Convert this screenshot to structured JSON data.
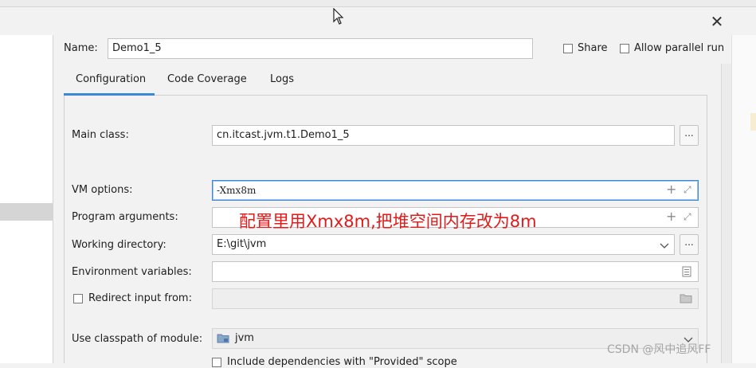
{
  "dialog": {
    "close_glyph": "✕",
    "name_label": "Name:",
    "name_value": "Demo1_5",
    "share_label": "Share",
    "allow_parallel_label": "Allow parallel run"
  },
  "tabs": [
    {
      "label": "Configuration",
      "selected": true
    },
    {
      "label": "Code Coverage",
      "selected": false
    },
    {
      "label": "Logs",
      "selected": false
    }
  ],
  "form": {
    "main_class_label": "Main class:",
    "main_class_value": "cn.itcast.jvm.t1.Demo1_5",
    "vm_options_label": "VM options:",
    "vm_options_value": "-Xmx8m",
    "program_args_label": "Program arguments:",
    "working_dir_label": "Working directory:",
    "working_dir_value": "E:\\git\\jvm",
    "env_vars_label": "Environment variables:",
    "redirect_label": "Redirect input from:",
    "classpath_label": "Use classpath of module:",
    "classpath_value": "jvm",
    "include_deps_label": "Include dependencies with \"Provided\" scope",
    "browse_glyph": "...",
    "expand_glyph": "⤢",
    "plus_glyph": "+"
  },
  "annotation": "配置里用Xmx8m,把堆空间内存改为8m",
  "watermark": "CSDN @风中追风FF",
  "colors": {
    "accent": "#3d87d6",
    "annotation": "#e21a1a"
  },
  "icons": [
    "close-icon",
    "cursor-icon",
    "plus-icon",
    "expand-icon",
    "dropdown-chevron-icon",
    "file-icon",
    "folder-icon",
    "module-folder-icon"
  ]
}
